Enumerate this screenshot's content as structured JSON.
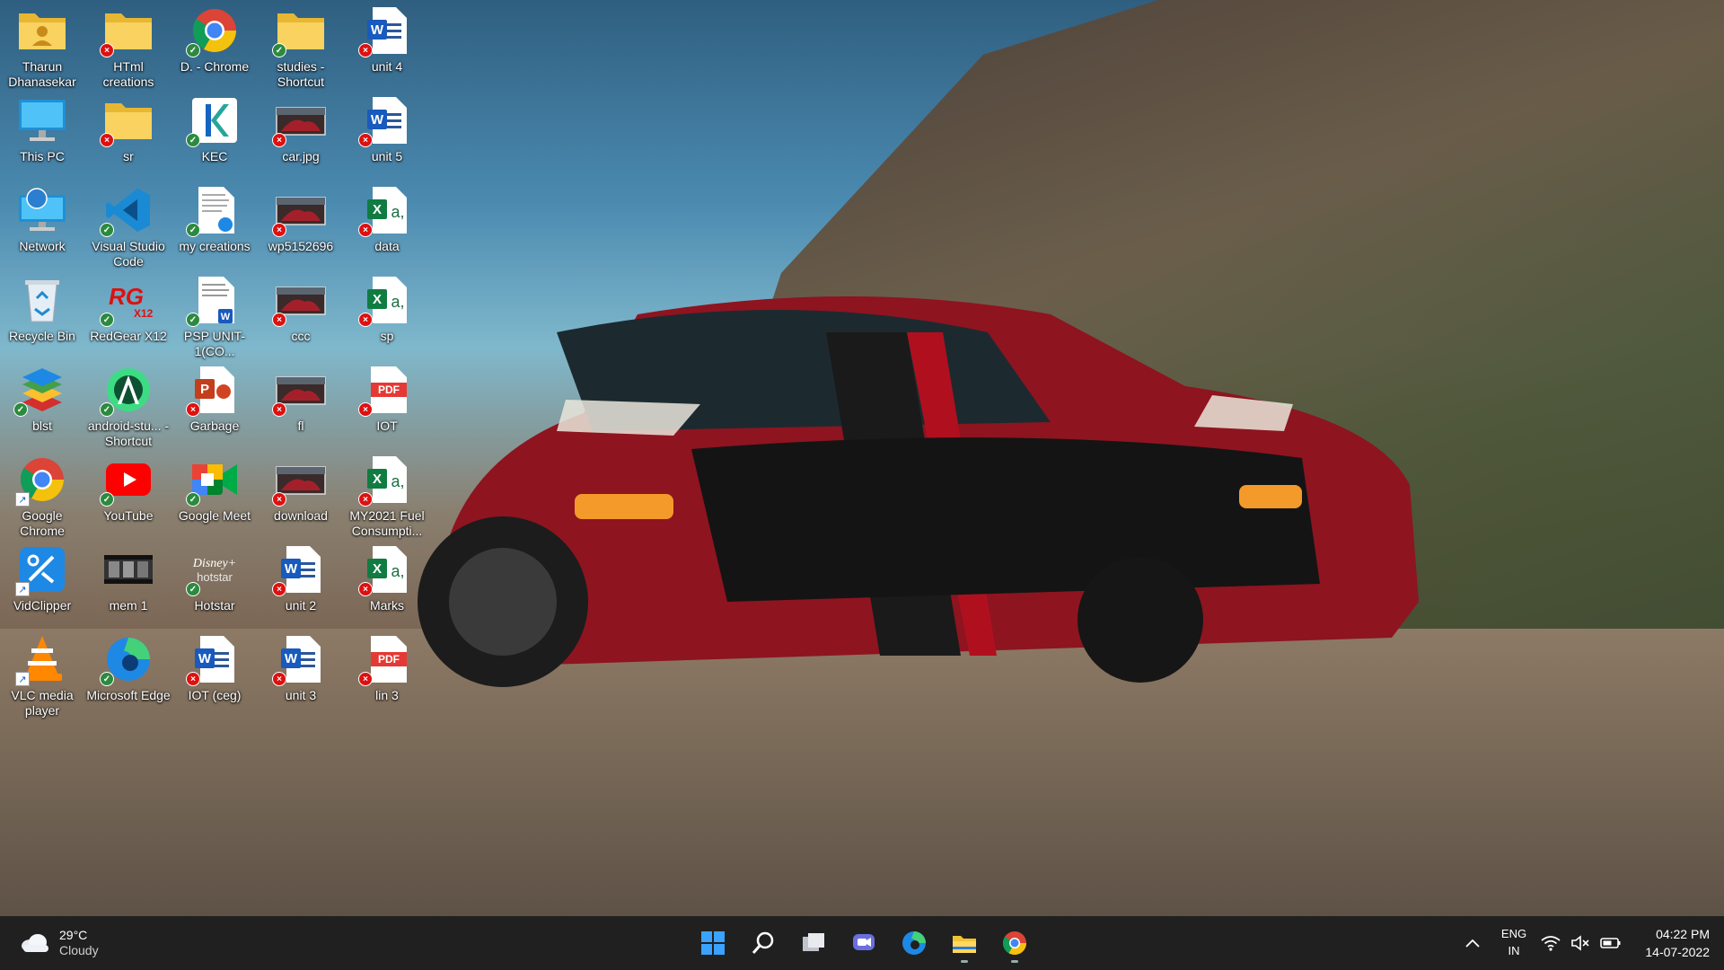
{
  "desktop": {
    "icons": [
      {
        "label": "Tharun Dhanasekar",
        "icon": "user-folder-icon",
        "badge": ""
      },
      {
        "label": "HTml creations",
        "icon": "folder-icon",
        "badge": "err"
      },
      {
        "label": "D. - Chrome",
        "icon": "chrome-icon",
        "badge": "ok"
      },
      {
        "label": "studies - Shortcut",
        "icon": "folder-icon",
        "badge": "ok"
      },
      {
        "label": "unit 4",
        "icon": "word-icon",
        "badge": "err"
      },
      {
        "label": "This PC",
        "icon": "monitor-icon",
        "badge": ""
      },
      {
        "label": "sr",
        "icon": "folder-icon",
        "badge": "err"
      },
      {
        "label": "KEC",
        "icon": "kec-icon",
        "badge": "ok"
      },
      {
        "label": "car.jpg",
        "icon": "image-icon",
        "badge": "err"
      },
      {
        "label": "unit 5",
        "icon": "word-icon",
        "badge": "err"
      },
      {
        "label": "Network",
        "icon": "network-icon",
        "badge": ""
      },
      {
        "label": "Visual Studio Code",
        "icon": "vscode-icon",
        "badge": "ok"
      },
      {
        "label": "my creations",
        "icon": "document-icon",
        "badge": "ok"
      },
      {
        "label": "wp5152696",
        "icon": "image-icon",
        "badge": "err"
      },
      {
        "label": "data",
        "icon": "excel-icon",
        "badge": "err"
      },
      {
        "label": "Recycle Bin",
        "icon": "recycle-bin-icon",
        "badge": ""
      },
      {
        "label": "RedGear X12",
        "icon": "redgear-icon",
        "badge": "ok"
      },
      {
        "label": "PSP UNIT-1(CO...",
        "icon": "word-doc-icon",
        "badge": "ok"
      },
      {
        "label": "ccc",
        "icon": "image-icon",
        "badge": "err"
      },
      {
        "label": "sp",
        "icon": "excel-icon",
        "badge": "err"
      },
      {
        "label": "blst",
        "icon": "bluestacks-icon",
        "badge": "ok"
      },
      {
        "label": "android-stu... - Shortcut",
        "icon": "android-studio-icon",
        "badge": "ok"
      },
      {
        "label": "Garbage",
        "icon": "powerpoint-icon",
        "badge": "err"
      },
      {
        "label": "fl",
        "icon": "image-icon",
        "badge": "err"
      },
      {
        "label": "IOT",
        "icon": "pdf-icon",
        "badge": "err"
      },
      {
        "label": "Google Chrome",
        "icon": "chrome-icon",
        "badge": "shortcut"
      },
      {
        "label": "YouTube",
        "icon": "youtube-icon",
        "badge": "ok"
      },
      {
        "label": "Google Meet",
        "icon": "google-meet-icon",
        "badge": "ok"
      },
      {
        "label": "download",
        "icon": "image-icon",
        "badge": "err"
      },
      {
        "label": "MY2021 Fuel Consumpti...",
        "icon": "excel-icon",
        "badge": "err"
      },
      {
        "label": "VidClipper",
        "icon": "vidclipper-icon",
        "badge": "shortcut"
      },
      {
        "label": "mem 1",
        "icon": "video-icon",
        "badge": ""
      },
      {
        "label": "Hotstar",
        "icon": "hotstar-icon",
        "badge": "ok"
      },
      {
        "label": "unit 2",
        "icon": "word-icon",
        "badge": "err"
      },
      {
        "label": "Marks",
        "icon": "excel-icon",
        "badge": "err"
      },
      {
        "label": "VLC media player",
        "icon": "vlc-icon",
        "badge": "shortcut"
      },
      {
        "label": "Microsoft Edge",
        "icon": "edge-icon",
        "badge": "ok"
      },
      {
        "label": "IOT (ceg)",
        "icon": "word-icon",
        "badge": "err"
      },
      {
        "label": "unit 3",
        "icon": "word-icon",
        "badge": "err"
      },
      {
        "label": "lin 3",
        "icon": "pdf-icon",
        "badge": "err"
      }
    ]
  },
  "taskbar": {
    "weather": {
      "temp": "29°C",
      "condition": "Cloudy",
      "icon": "cloud-icon"
    },
    "apps": [
      "start-icon",
      "search-icon",
      "task-view-icon",
      "chat-icon",
      "edge-icon",
      "file-explorer-icon",
      "chrome-icon"
    ],
    "tray": {
      "language_top": "ENG",
      "language_bottom": "IN",
      "time": "04:22 PM",
      "date": "14-07-2022"
    }
  }
}
